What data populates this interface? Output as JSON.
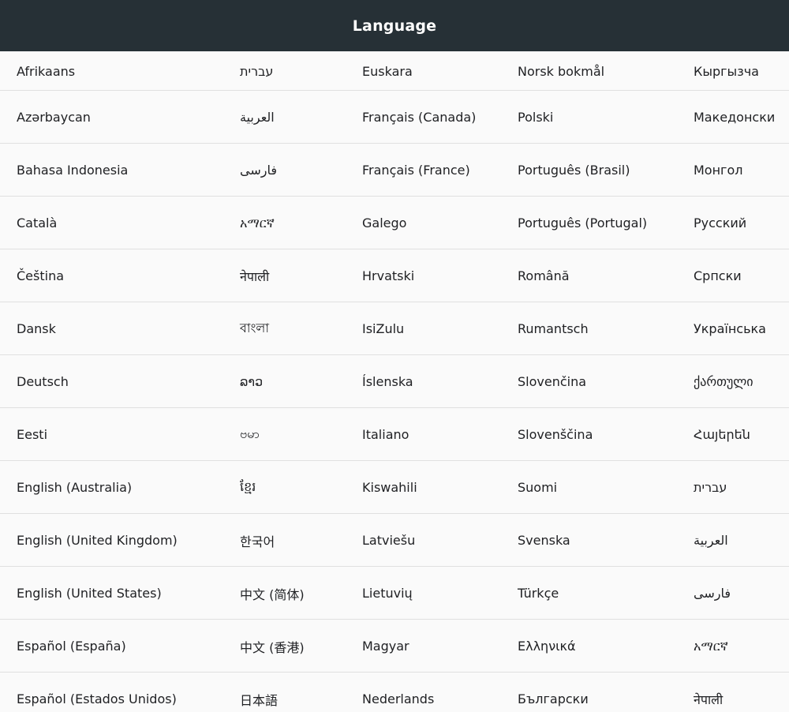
{
  "header": {
    "title": "Language"
  },
  "languages": {
    "col0": [
      "Afrikaans",
      "Azərbaycan",
      "Bahasa Indonesia",
      "Català",
      "Čeština",
      "Dansk",
      "Deutsch",
      "Eesti",
      "English (Australia)",
      "English (United Kingdom)",
      "English (United States)",
      "Español (España)",
      "Español (Estados Unidos)"
    ],
    "col1": [
      "עברית",
      "العربية",
      "فارسی",
      "አማርኛ",
      "नेपाली",
      "বাংলা",
      "ລາວ",
      "ဗမာ",
      "ខ្មែរ",
      "한국어",
      "中文 (简体)",
      "中文 (香港)",
      "日本語"
    ],
    "col2": [
      "Euskara",
      "Français (Canada)",
      "Français (France)",
      "Galego",
      "Hrvatski",
      "IsiZulu",
      "Íslenska",
      "Italiano",
      "Kiswahili",
      "Latviešu",
      "Lietuvių",
      "Magyar",
      "Nederlands"
    ],
    "col3": [
      "Norsk bokmål",
      "Polski",
      "Português (Brasil)",
      "Português (Portugal)",
      "Română",
      "Rumantsch",
      "Slovenčina",
      "Slovenščina",
      "Suomi",
      "Svenska",
      "Türkçe",
      "Ελληνικά",
      "Български"
    ],
    "col4": [
      "Кыргызча",
      "Македонски",
      "Монгол",
      "Русский",
      "Српски",
      "Українська",
      "ქართული",
      "Հայերեն",
      "עברית",
      "العربية",
      "فارسی",
      "አማርኛ",
      "नेपाली"
    ]
  }
}
